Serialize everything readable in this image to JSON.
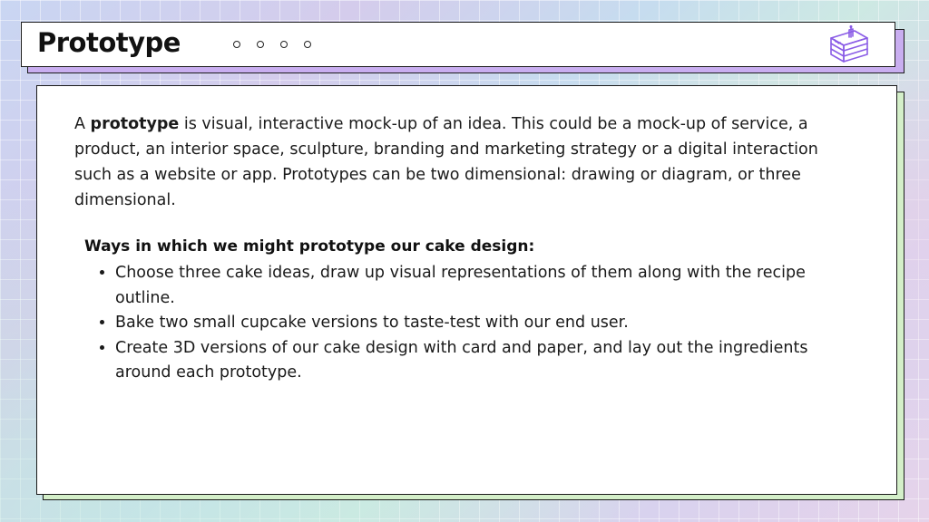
{
  "header": {
    "title": "Prototype",
    "decor_dots": 4,
    "icon": "cake-slice-icon"
  },
  "content": {
    "intro_prefix": "A ",
    "intro_term": "prototype",
    "intro_rest": " is visual, interactive mock-up of an idea. This could be a mock-up of service, a product, an interior space, sculpture, branding and marketing strategy or a digital interaction such as a website or app. Prototypes can be two dimensional: drawing or diagram, or three dimensional.",
    "ways_heading": "Ways in which we might prototype our cake design:",
    "ways": [
      "Choose three cake ideas, draw up visual representations of them along with the recipe outline.",
      "Bake two small cupcake versions to taste-test with our end user.",
      "Create 3D versions of our cake design with card and paper, and lay out the ingredients around each prototype."
    ]
  },
  "colors": {
    "title_shadow": "#c9aef0",
    "card_shadow": "#d4efc9",
    "icon_stroke": "#8a5ce6"
  }
}
